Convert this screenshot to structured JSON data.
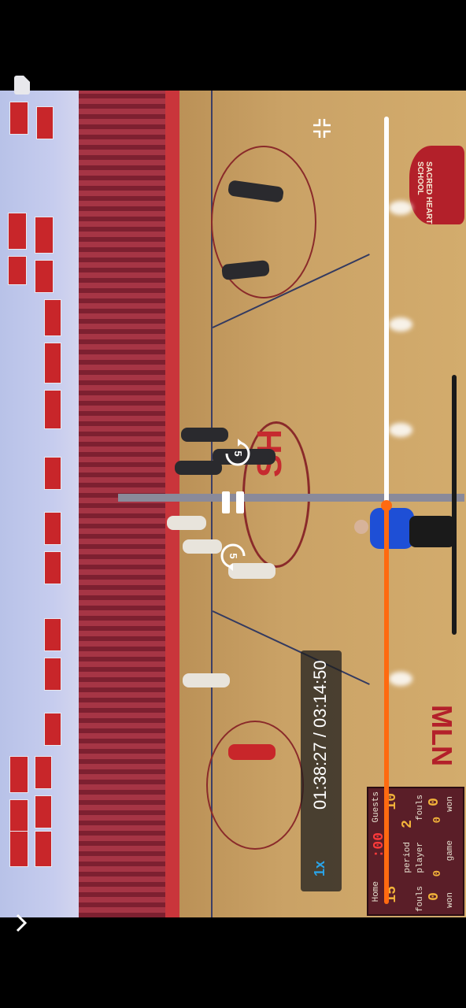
{
  "player": {
    "time_display": "01:38:27 / 03:14:50",
    "speed_label": "1x",
    "progress_fraction": 0.506,
    "skip_back_seconds": "5",
    "skip_forward_seconds": "5",
    "accent_color": "#ff6a10"
  },
  "icons": {
    "top_left": "document-icon",
    "collapse": "collapse-fullscreen-icon",
    "pause": "pause-icon",
    "skip_back": "skip-back-icon",
    "skip_forward": "skip-forward-icon",
    "chevron": "chevron-right-icon"
  },
  "video": {
    "center_logo_text": "SH",
    "baseline_text": "MLN",
    "seal_text": "SACRED HEART SCHOOL",
    "scoreboard": {
      "home_label": "Home",
      "guests_label": "Guests",
      "home_score": "15",
      "guests_score": "10",
      "clock": ":00",
      "period_label": "period",
      "period_value": "2",
      "player_label": "player",
      "fouls_label": "fouls",
      "fouls_home": "0",
      "fouls_guests": "0",
      "won_label": "won",
      "game_label": "game",
      "won_home": "0",
      "won_guests": "0"
    }
  }
}
